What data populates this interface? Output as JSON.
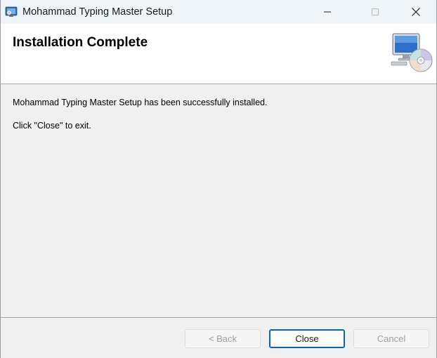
{
  "window": {
    "title": "Mohammad Typing Master Setup"
  },
  "icons": {
    "app": "installer-app-icon",
    "minimize": "minimize-icon",
    "maximize": "maximize-icon",
    "close": "close-icon",
    "banner": "computer-cd-icon"
  },
  "banner": {
    "title": "Installation Complete"
  },
  "body": {
    "message": "Mohammad Typing Master Setup has been successfully installed.",
    "instruction": "Click \"Close\" to exit."
  },
  "buttons": {
    "back_label": "< Back",
    "close_label": "Close",
    "cancel_label": "Cancel",
    "back_enabled": false,
    "cancel_enabled": false
  },
  "colors": {
    "accent": "#0067c0",
    "titlebar": "#eef4f9",
    "dialog_bg": "#f0f0f0",
    "disabled_text": "#a0a0a0"
  }
}
